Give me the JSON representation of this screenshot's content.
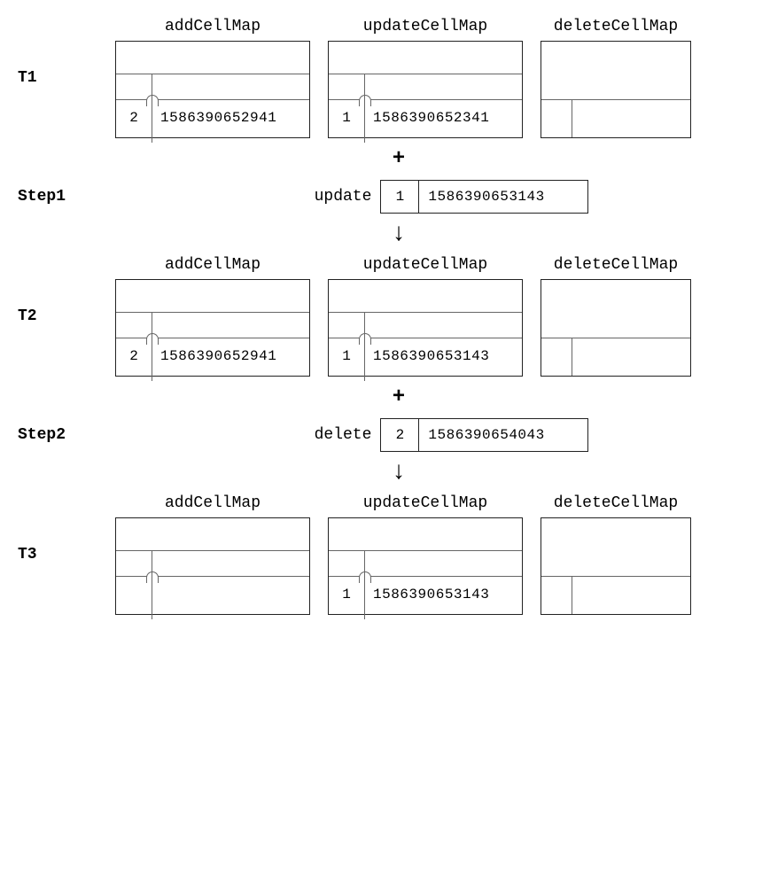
{
  "headers": {
    "addMap": "addCellMap",
    "updateMap": "updateCellMap",
    "deleteMap": "deleteCellMap"
  },
  "labels": {
    "t1": "T1",
    "t2": "T2",
    "t3": "T3",
    "step1": "Step1",
    "step2": "Step2"
  },
  "symbols": {
    "plus": "+",
    "arrowDown": "↓"
  },
  "states": {
    "t1": {
      "add": {
        "key": "2",
        "val": "1586390652941"
      },
      "update": {
        "key": "1",
        "val": "1586390652341"
      },
      "delete": {
        "key": "",
        "val": ""
      }
    },
    "t2": {
      "add": {
        "key": "2",
        "val": "1586390652941"
      },
      "update": {
        "key": "1",
        "val": "1586390653143"
      },
      "delete": {
        "key": "",
        "val": ""
      }
    },
    "t3": {
      "add": {
        "key": "",
        "val": ""
      },
      "update": {
        "key": "1",
        "val": "1586390653143"
      },
      "delete": {
        "key": "",
        "val": ""
      }
    }
  },
  "ops": {
    "step1": {
      "label": "update",
      "key": "1",
      "val": "1586390653143"
    },
    "step2": {
      "label": "delete",
      "key": "2",
      "val": "1586390654043"
    }
  }
}
